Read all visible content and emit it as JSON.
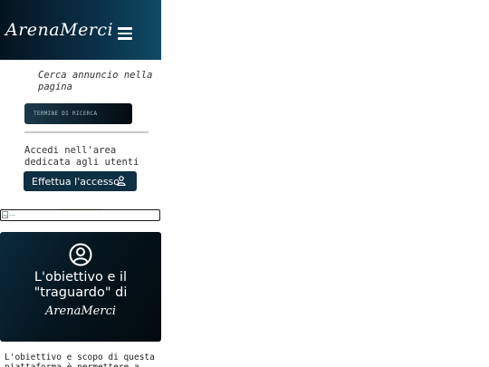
{
  "header": {
    "brand": "ArenaMerci",
    "menu_icon": "hamburger-icon"
  },
  "search": {
    "label": "Cerca annuncio nella pagina",
    "placeholder": "TERMINE DI RICERCA"
  },
  "login": {
    "label": "Accedi nell'area dedicata agli utenti",
    "button_label": "Effettua l'accesso",
    "button_icon": "user-icon"
  },
  "image": {
    "alt": "..."
  },
  "hero": {
    "icon": "user-circle-icon",
    "title": "L'obiettivo e il \"traguardo\" di",
    "brand": "ArenaMerci"
  },
  "body": {
    "text": "L'obiettivo e scopo di questa piattaforma è permettere a"
  },
  "colors": {
    "header_dark": "#04141f",
    "header_light": "#104a66",
    "button_bg": "#0f2f42",
    "hero_bg": "#05141d"
  }
}
